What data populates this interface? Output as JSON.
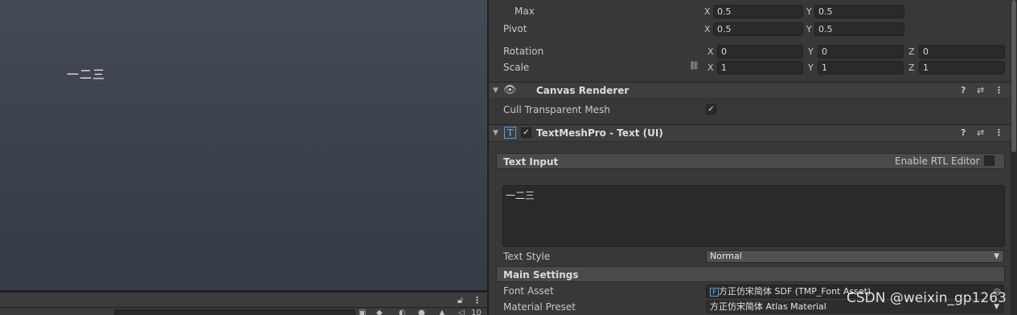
{
  "scene": {
    "text": "一二三"
  },
  "bottom_bar": {
    "lock_icon": "lock-icon",
    "menu_icon": "kebab-menu-icon",
    "count": "10"
  },
  "rect_transform": {
    "max_label": "Max",
    "max_x": "0.5",
    "max_y": "0.5",
    "pivot_label": "Pivot",
    "pivot_x": "0.5",
    "pivot_y": "0.5",
    "rotation_label": "Rotation",
    "rotation_x": "0",
    "rotation_y": "0",
    "rotation_z": "0",
    "scale_label": "Scale",
    "scale_x": "1",
    "scale_y": "1",
    "scale_z": "1",
    "axis_x": "X",
    "axis_y": "Y",
    "axis_z": "Z"
  },
  "canvas_renderer": {
    "title": "Canvas Renderer",
    "cull_label": "Cull Transparent Mesh",
    "cull_checked": true
  },
  "tmp": {
    "title": "TextMeshPro - Text (UI)",
    "text_input_label": "Text Input",
    "rtl_label": "Enable RTL Editor",
    "text_value": "一二三",
    "text_style_label": "Text Style",
    "text_style_value": "Normal",
    "main_settings_label": "Main Settings",
    "font_asset_label": "Font Asset",
    "font_asset_value": "方正仿宋简体 SDF (TMP_Font Asset)",
    "material_preset_label": "Material Preset",
    "material_preset_value": "方正仿宋简体 Atlas Material"
  },
  "watermark": "CSDN @weixin_gp1263",
  "icons": {
    "help": "?",
    "presets": "⇄",
    "more": "⋮"
  }
}
